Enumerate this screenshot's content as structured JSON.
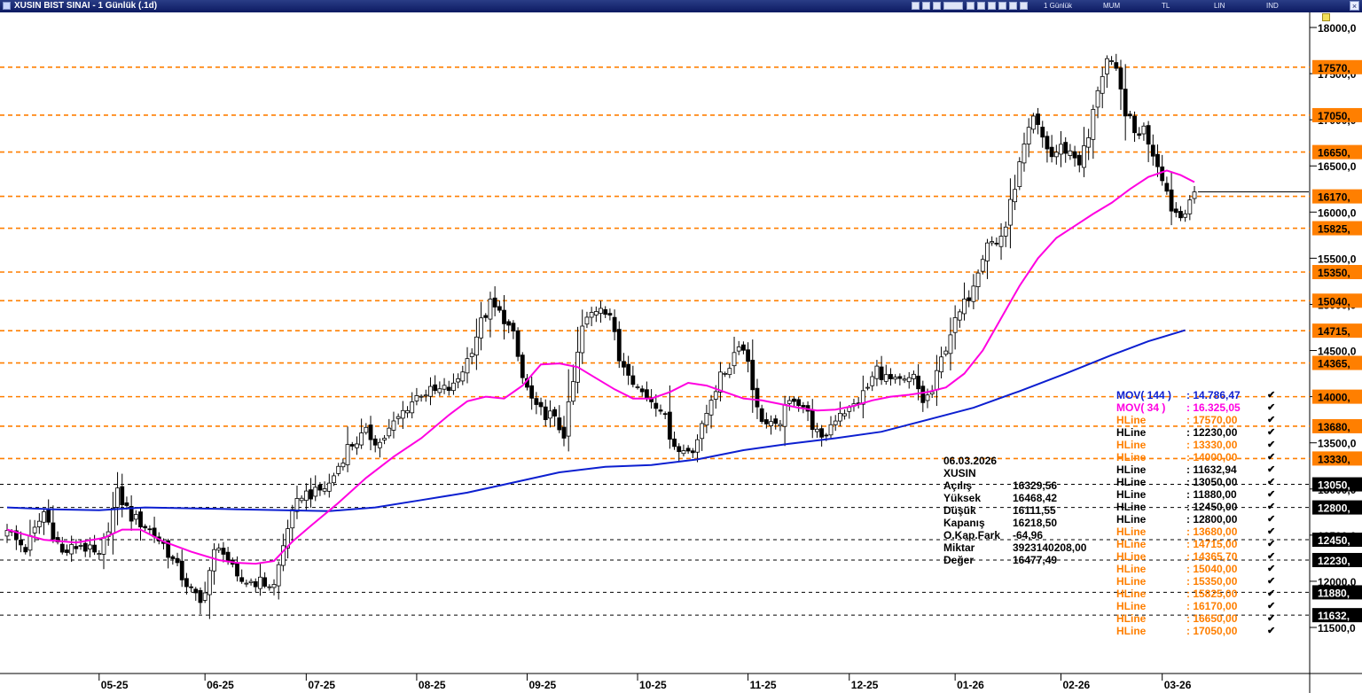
{
  "window": {
    "title": "XUSIN BIST SINAI - 1 Günlük (.1d)",
    "toolbar": {
      "period": "1 Günlük",
      "chart_type": "MUM",
      "currency": "TL",
      "scale": "LIN",
      "mode": "IND"
    },
    "close_symbol": "×"
  },
  "colors": {
    "orange_line": "#ff7f00",
    "black_line": "#000000",
    "ma144": "#0c1fd0",
    "ma34": "#ff00e0",
    "candle_up": "#ffffff",
    "candle_down": "#000000",
    "price_marker": "#000000"
  },
  "info_box": {
    "date": "06.03.2026",
    "symbol": "XUSIN",
    "rows": [
      {
        "label": "Açılış",
        "value": "16329,56"
      },
      {
        "label": "Yüksek",
        "value": "16468,42"
      },
      {
        "label": "Düşük",
        "value": "16111,55"
      },
      {
        "label": "Kapanış",
        "value": "16218,50"
      },
      {
        "label": "O.Kap.Fark",
        "value": "-64,96"
      },
      {
        "label": "Miktar",
        "value": "3923140208,00"
      },
      {
        "label": "Değer",
        "value": "16477,49"
      }
    ]
  },
  "legend": [
    {
      "name": "MOV( 144 )",
      "value": ": 14.786,47",
      "color": "#0c1fd0"
    },
    {
      "name": "MOV( 34 )",
      "value": ": 16.325,05",
      "color": "#ff00e0"
    },
    {
      "name": "HLine",
      "value": ": 17570,00",
      "color": "#ff7f00"
    },
    {
      "name": "HLine",
      "value": ": 12230,00",
      "color": "#000000"
    },
    {
      "name": "HLine",
      "value": ": 13330,00",
      "color": "#ff7f00"
    },
    {
      "name": "HLine",
      "value": ": 14000,00",
      "color": "#ff7f00"
    },
    {
      "name": "HLine",
      "value": ": 11632,94",
      "color": "#000000"
    },
    {
      "name": "HLine",
      "value": ": 13050,00",
      "color": "#000000"
    },
    {
      "name": "HLine",
      "value": ": 11880,00",
      "color": "#000000"
    },
    {
      "name": "HLine",
      "value": ": 12450,00",
      "color": "#000000"
    },
    {
      "name": "HLine",
      "value": ": 12800,00",
      "color": "#000000"
    },
    {
      "name": "HLine",
      "value": ": 13680,00",
      "color": "#ff7f00"
    },
    {
      "name": "HLine",
      "value": ": 14715,00",
      "color": "#ff7f00"
    },
    {
      "name": "HLine",
      "value": ": 14365,70",
      "color": "#ff7f00"
    },
    {
      "name": "HLine",
      "value": ": 15040,00",
      "color": "#ff7f00"
    },
    {
      "name": "HLine",
      "value": ": 15350,00",
      "color": "#ff7f00"
    },
    {
      "name": "HLine",
      "value": ": 15825,00",
      "color": "#ff7f00"
    },
    {
      "name": "HLine",
      "value": ": 16170,00",
      "color": "#ff7f00"
    },
    {
      "name": "HLine",
      "value": ": 16650,00",
      "color": "#ff7f00"
    },
    {
      "name": "HLine",
      "value": ": 17050,00",
      "color": "#ff7f00"
    }
  ],
  "legend_check": "✔",
  "chart_data": {
    "type": "candlestick",
    "symbol": "XUSIN",
    "ylim": [
      11350,
      18100
    ],
    "y_ticks": [
      11500,
      12000,
      12500,
      13000,
      13500,
      14000,
      14500,
      15000,
      15500,
      16000,
      16500,
      17000,
      17500,
      18000
    ],
    "y_tick_labels": [
      "11500,0",
      "12000,0",
      "12500,0",
      "13000,0",
      "13500,0",
      "14000,0",
      "14500,0",
      "15000,0",
      "15500,0",
      "16000,0",
      "16500,0",
      "17000,0",
      "17500,0",
      "18000,0"
    ],
    "x_labels": [
      {
        "label": "05-25",
        "bar": 20
      },
      {
        "label": "06-25",
        "bar": 43
      },
      {
        "label": "07-25",
        "bar": 65
      },
      {
        "label": "08-25",
        "bar": 89
      },
      {
        "label": "09-25",
        "bar": 113
      },
      {
        "label": "10-25",
        "bar": 137
      },
      {
        "label": "11-25",
        "bar": 161
      },
      {
        "label": "12-25",
        "bar": 183
      },
      {
        "label": "01-26",
        "bar": 206
      },
      {
        "label": "02-26",
        "bar": 229
      },
      {
        "label": "03-26",
        "bar": 251
      }
    ],
    "hlines": [
      {
        "value": 17570,
        "label": "17570,",
        "style": "orange"
      },
      {
        "value": 17050,
        "label": "17050,",
        "style": "orange"
      },
      {
        "value": 16650,
        "label": "16650,",
        "style": "orange"
      },
      {
        "value": 16170,
        "label": "16170,",
        "style": "orange"
      },
      {
        "value": 15825,
        "label": "15825,",
        "style": "orange"
      },
      {
        "value": 15350,
        "label": "15350,",
        "style": "orange"
      },
      {
        "value": 15040,
        "label": "15040,",
        "style": "orange"
      },
      {
        "value": 14715,
        "label": "14715,",
        "style": "orange"
      },
      {
        "value": 14365.7,
        "label": "14365,",
        "style": "orange"
      },
      {
        "value": 14000,
        "label": "14000,",
        "style": "orange"
      },
      {
        "value": 13680,
        "label": "13680,",
        "style": "orange"
      },
      {
        "value": 13330,
        "label": "13330,",
        "style": "orange"
      },
      {
        "value": 13050,
        "label": "13050,",
        "style": "black"
      },
      {
        "value": 12800,
        "label": "12800,",
        "style": "black"
      },
      {
        "value": 12450,
        "label": "12450,",
        "style": "black"
      },
      {
        "value": 12230,
        "label": "12230,",
        "style": "black"
      },
      {
        "value": 11880,
        "label": "11880,",
        "style": "black"
      },
      {
        "value": 11632.94,
        "label": "11632,",
        "style": "black"
      }
    ],
    "last_close": 16218.5,
    "anchors": [
      [
        0,
        12550
      ],
      [
        4,
        12350
      ],
      [
        8,
        12750
      ],
      [
        12,
        12300
      ],
      [
        16,
        12400
      ],
      [
        20,
        12250
      ],
      [
        24,
        12950
      ],
      [
        27,
        12700
      ],
      [
        30,
        12600
      ],
      [
        34,
        12400
      ],
      [
        38,
        12050
      ],
      [
        42,
        11750
      ],
      [
        45,
        12300
      ],
      [
        47,
        12350
      ],
      [
        50,
        12000
      ],
      [
        54,
        12000
      ],
      [
        58,
        11950
      ],
      [
        61,
        12600
      ],
      [
        64,
        12950
      ],
      [
        67,
        12950
      ],
      [
        70,
        13050
      ],
      [
        74,
        13450
      ],
      [
        78,
        13600
      ],
      [
        81,
        13500
      ],
      [
        84,
        13700
      ],
      [
        87,
        13900
      ],
      [
        90,
        14050
      ],
      [
        93,
        14050
      ],
      [
        97,
        14100
      ],
      [
        100,
        14400
      ],
      [
        103,
        14800
      ],
      [
        105,
        15000
      ],
      [
        108,
        14850
      ],
      [
        110,
        14650
      ],
      [
        112,
        14200
      ],
      [
        115,
        13850
      ],
      [
        118,
        13800
      ],
      [
        121,
        13600
      ],
      [
        123,
        14150
      ],
      [
        125,
        14750
      ],
      [
        127,
        14900
      ],
      [
        129,
        15000
      ],
      [
        131,
        14900
      ],
      [
        133,
        14400
      ],
      [
        135,
        14300
      ],
      [
        137,
        14100
      ],
      [
        139,
        14000
      ],
      [
        142,
        13900
      ],
      [
        144,
        13600
      ],
      [
        146,
        13400
      ],
      [
        149,
        13450
      ],
      [
        151,
        13650
      ],
      [
        153,
        14000
      ],
      [
        155,
        14200
      ],
      [
        157,
        14350
      ],
      [
        159,
        14600
      ],
      [
        161,
        14400
      ],
      [
        163,
        13850
      ],
      [
        165,
        13700
      ],
      [
        167,
        13650
      ],
      [
        169,
        13850
      ],
      [
        171,
        14000
      ],
      [
        173,
        13900
      ],
      [
        175,
        13700
      ],
      [
        177,
        13500
      ],
      [
        179,
        13700
      ],
      [
        181,
        13850
      ],
      [
        183,
        13850
      ],
      [
        185,
        13950
      ],
      [
        187,
        14100
      ],
      [
        189,
        14300
      ],
      [
        191,
        14200
      ],
      [
        193,
        14150
      ],
      [
        195,
        14150
      ],
      [
        197,
        14200
      ],
      [
        199,
        13950
      ],
      [
        201,
        14050
      ],
      [
        203,
        14400
      ],
      [
        205,
        14700
      ],
      [
        207,
        14900
      ],
      [
        209,
        15100
      ],
      [
        211,
        15400
      ],
      [
        213,
        15700
      ],
      [
        215,
        15650
      ],
      [
        217,
        15850
      ],
      [
        219,
        16300
      ],
      [
        221,
        16700
      ],
      [
        223,
        17000
      ],
      [
        225,
        16800
      ],
      [
        227,
        16600
      ],
      [
        229,
        16700
      ],
      [
        231,
        16650
      ],
      [
        233,
        16550
      ],
      [
        235,
        16800
      ],
      [
        237,
        17350
      ],
      [
        239,
        17650
      ],
      [
        241,
        17500
      ],
      [
        243,
        17100
      ],
      [
        245,
        16850
      ],
      [
        247,
        16900
      ],
      [
        249,
        16650
      ],
      [
        251,
        16400
      ],
      [
        253,
        16050
      ],
      [
        255,
        15950
      ],
      [
        257,
        16150
      ],
      [
        258,
        16218.5
      ]
    ],
    "ma34_points": [
      [
        0,
        12560
      ],
      [
        8,
        12450
      ],
      [
        15,
        12420
      ],
      [
        21,
        12470
      ],
      [
        25,
        12560
      ],
      [
        29,
        12560
      ],
      [
        34,
        12430
      ],
      [
        40,
        12320
      ],
      [
        46,
        12230
      ],
      [
        50,
        12200
      ],
      [
        54,
        12190
      ],
      [
        58,
        12220
      ],
      [
        62,
        12430
      ],
      [
        66,
        12600
      ],
      [
        72,
        12850
      ],
      [
        78,
        13120
      ],
      [
        84,
        13350
      ],
      [
        90,
        13550
      ],
      [
        96,
        13800
      ],
      [
        100,
        13950
      ],
      [
        104,
        14000
      ],
      [
        108,
        13980
      ],
      [
        112,
        14120
      ],
      [
        116,
        14350
      ],
      [
        120,
        14360
      ],
      [
        124,
        14320
      ],
      [
        128,
        14200
      ],
      [
        132,
        14080
      ],
      [
        136,
        13980
      ],
      [
        140,
        13980
      ],
      [
        144,
        14050
      ],
      [
        148,
        14150
      ],
      [
        152,
        14120
      ],
      [
        156,
        14050
      ],
      [
        160,
        13980
      ],
      [
        164,
        13960
      ],
      [
        168,
        13920
      ],
      [
        172,
        13880
      ],
      [
        176,
        13850
      ],
      [
        180,
        13860
      ],
      [
        184,
        13900
      ],
      [
        188,
        13960
      ],
      [
        192,
        14000
      ],
      [
        196,
        14020
      ],
      [
        200,
        14050
      ],
      [
        204,
        14100
      ],
      [
        208,
        14250
      ],
      [
        212,
        14500
      ],
      [
        216,
        14850
      ],
      [
        220,
        15200
      ],
      [
        224,
        15500
      ],
      [
        228,
        15720
      ],
      [
        232,
        15850
      ],
      [
        236,
        15980
      ],
      [
        240,
        16100
      ],
      [
        244,
        16250
      ],
      [
        248,
        16380
      ],
      [
        252,
        16450
      ],
      [
        255,
        16400
      ],
      [
        258,
        16325
      ]
    ],
    "ma144_points": [
      [
        0,
        12800
      ],
      [
        10,
        12780
      ],
      [
        20,
        12770
      ],
      [
        30,
        12800
      ],
      [
        40,
        12790
      ],
      [
        50,
        12780
      ],
      [
        60,
        12770
      ],
      [
        70,
        12760
      ],
      [
        80,
        12800
      ],
      [
        90,
        12880
      ],
      [
        100,
        12960
      ],
      [
        110,
        13070
      ],
      [
        120,
        13180
      ],
      [
        130,
        13240
      ],
      [
        140,
        13260
      ],
      [
        150,
        13320
      ],
      [
        160,
        13420
      ],
      [
        170,
        13490
      ],
      [
        180,
        13550
      ],
      [
        190,
        13620
      ],
      [
        200,
        13750
      ],
      [
        210,
        13880
      ],
      [
        220,
        14060
      ],
      [
        230,
        14250
      ],
      [
        240,
        14450
      ],
      [
        248,
        14600
      ],
      [
        256,
        14720
      ]
    ]
  }
}
